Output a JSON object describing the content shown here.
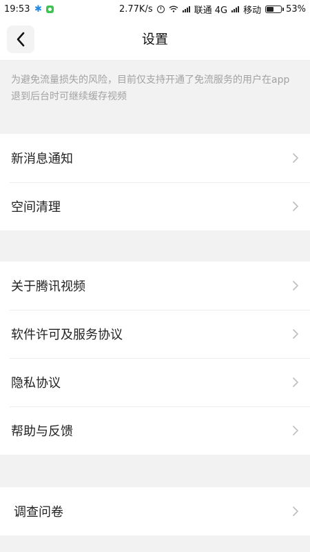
{
  "status_bar": {
    "time": "19:53",
    "network_speed": "2.77K/s",
    "carrier1": "联通 4G",
    "carrier2": "移动",
    "battery_percent": "53%",
    "battery_level": 0.53,
    "icons": [
      "bluetooth-icon",
      "app-notification-icon",
      "alarm-icon",
      "wifi-icon",
      "signal-icon",
      "signal-icon",
      "battery-icon"
    ]
  },
  "header": {
    "title": "设置",
    "back_icon": "chevron-left-icon"
  },
  "notice": {
    "text": "为避免流量损失的风险，目前仅支持开通了免流服务的用户在app退到后台时可继续缓存视频"
  },
  "groups": [
    {
      "items": [
        {
          "label": "新消息通知"
        },
        {
          "label": "空间清理"
        }
      ]
    },
    {
      "items": [
        {
          "label": "关于腾讯视频"
        },
        {
          "label": "软件许可及服务协议"
        },
        {
          "label": "隐私协议"
        },
        {
          "label": "帮助与反馈"
        }
      ]
    },
    {
      "items": [
        {
          "label": "调查问卷"
        }
      ]
    }
  ],
  "colors": {
    "background": "#f2f2f2",
    "surface": "#ffffff",
    "hint_text": "#a2a2a2",
    "chevron": "#bdbdbd",
    "bluetooth": "#1e88e5",
    "app_badge": "#3cc44f"
  }
}
